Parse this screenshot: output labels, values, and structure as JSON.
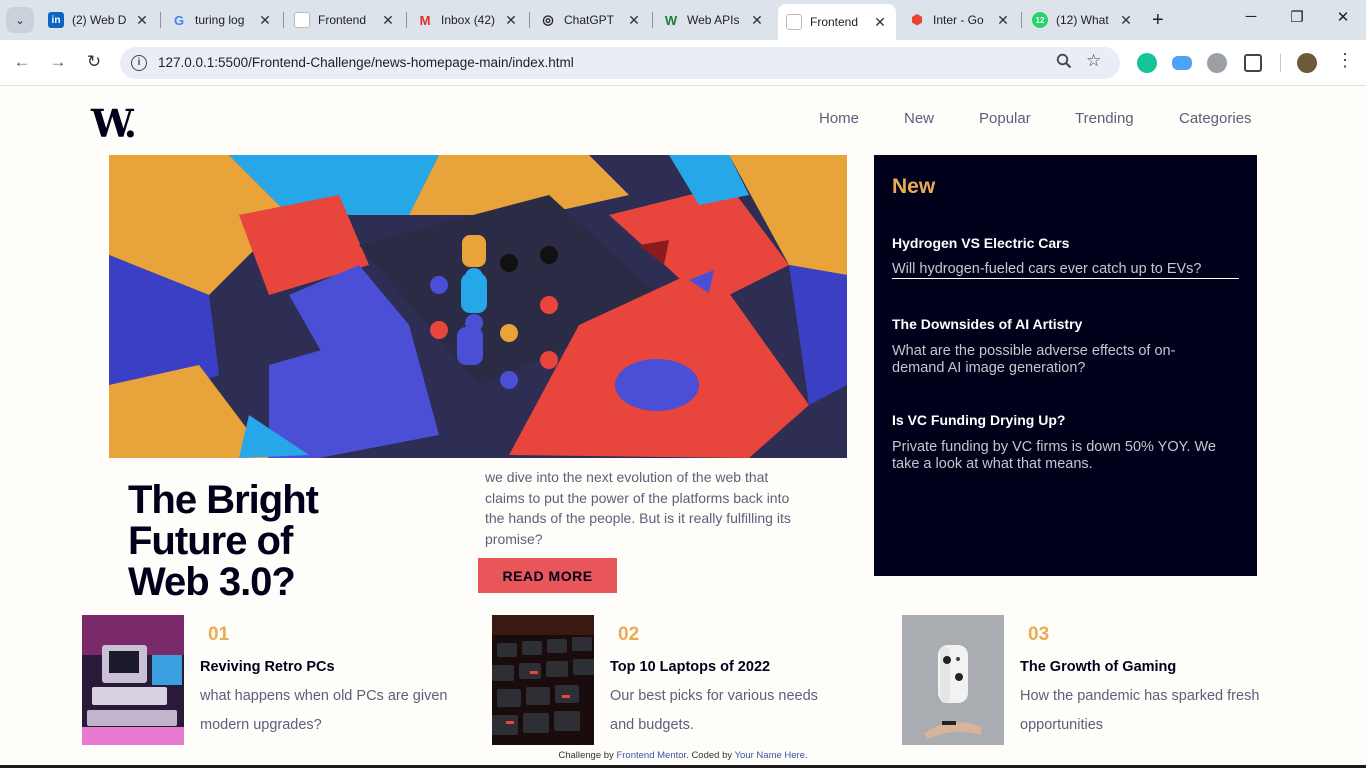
{
  "browser": {
    "tabs": [
      {
        "title": "(2) Web D",
        "favicon_color": "#0a66c2",
        "favicon_glyph": "in"
      },
      {
        "title": "turing log",
        "favicon_color": "#ffffff",
        "favicon_glyph": "G"
      },
      {
        "title": "Frontend",
        "favicon_color": "#ffffff",
        "favicon_glyph": ""
      },
      {
        "title": "Inbox (42)",
        "favicon_color": "#ffffff",
        "favicon_glyph": "M"
      },
      {
        "title": "ChatGPT",
        "favicon_color": "#ffffff",
        "favicon_glyph": "◎"
      },
      {
        "title": "Web APIs",
        "favicon_color": "#ffffff",
        "favicon_glyph": "W"
      },
      {
        "title": "Frontend",
        "favicon_color": "#ffffff",
        "favicon_glyph": ""
      },
      {
        "title": "Inter - Go",
        "favicon_color": "#ffffff",
        "favicon_glyph": "⬢"
      },
      {
        "title": "(12) What",
        "favicon_color": "#25d366",
        "favicon_glyph": "12"
      }
    ],
    "active_tab_index": 6,
    "url": "127.0.0.1:5500/Frontend-Challenge/news-homepage-main/index.html"
  },
  "site": {
    "logo": "W.",
    "nav": [
      "Home",
      "New",
      "Popular",
      "Trending",
      "Categories"
    ],
    "hero": {
      "title_lines": [
        "The Bright",
        "Future of",
        "Web 3.0?"
      ],
      "description": "we dive into the next evolution of the web that claims to put the power of the platforms back into the hands of the people. But is it really fulfilling its promise?",
      "button": "READ MORE"
    },
    "new_panel": {
      "title": "New",
      "items": [
        {
          "heading": "Hydrogen VS Electric Cars",
          "text": "Will hydrogen-fueled cars ever catch up to EVs?"
        },
        {
          "heading": "The Downsides of AI Artistry",
          "text": "What are the possible adverse effects of on-demand AI image generation?"
        },
        {
          "heading": "Is VC Funding Drying Up?",
          "text": "Private funding by VC firms is down 50% YOY. We take a look at what that means."
        }
      ]
    },
    "cards": [
      {
        "num": "01",
        "heading": "Reviving Retro PCs",
        "text": "what happens when old PCs are given modern upgrades?"
      },
      {
        "num": "02",
        "heading": "Top 10 Laptops of 2022",
        "text": "Our best picks for various needs and budgets."
      },
      {
        "num": "03",
        "heading": "The Growth of Gaming",
        "text": "How the pandemic has sparked fresh opportunities"
      }
    ],
    "footer": {
      "prefix": "Challenge by ",
      "fm": "Frontend Mentor",
      "mid": ". Coded by ",
      "name": "Your Name Here",
      "suffix": "."
    }
  },
  "colors": {
    "accent_orange": "#e9ab53",
    "accent_red": "#e9565a",
    "dark_navy": "#00001a",
    "text_gray": "#5d5f79"
  }
}
